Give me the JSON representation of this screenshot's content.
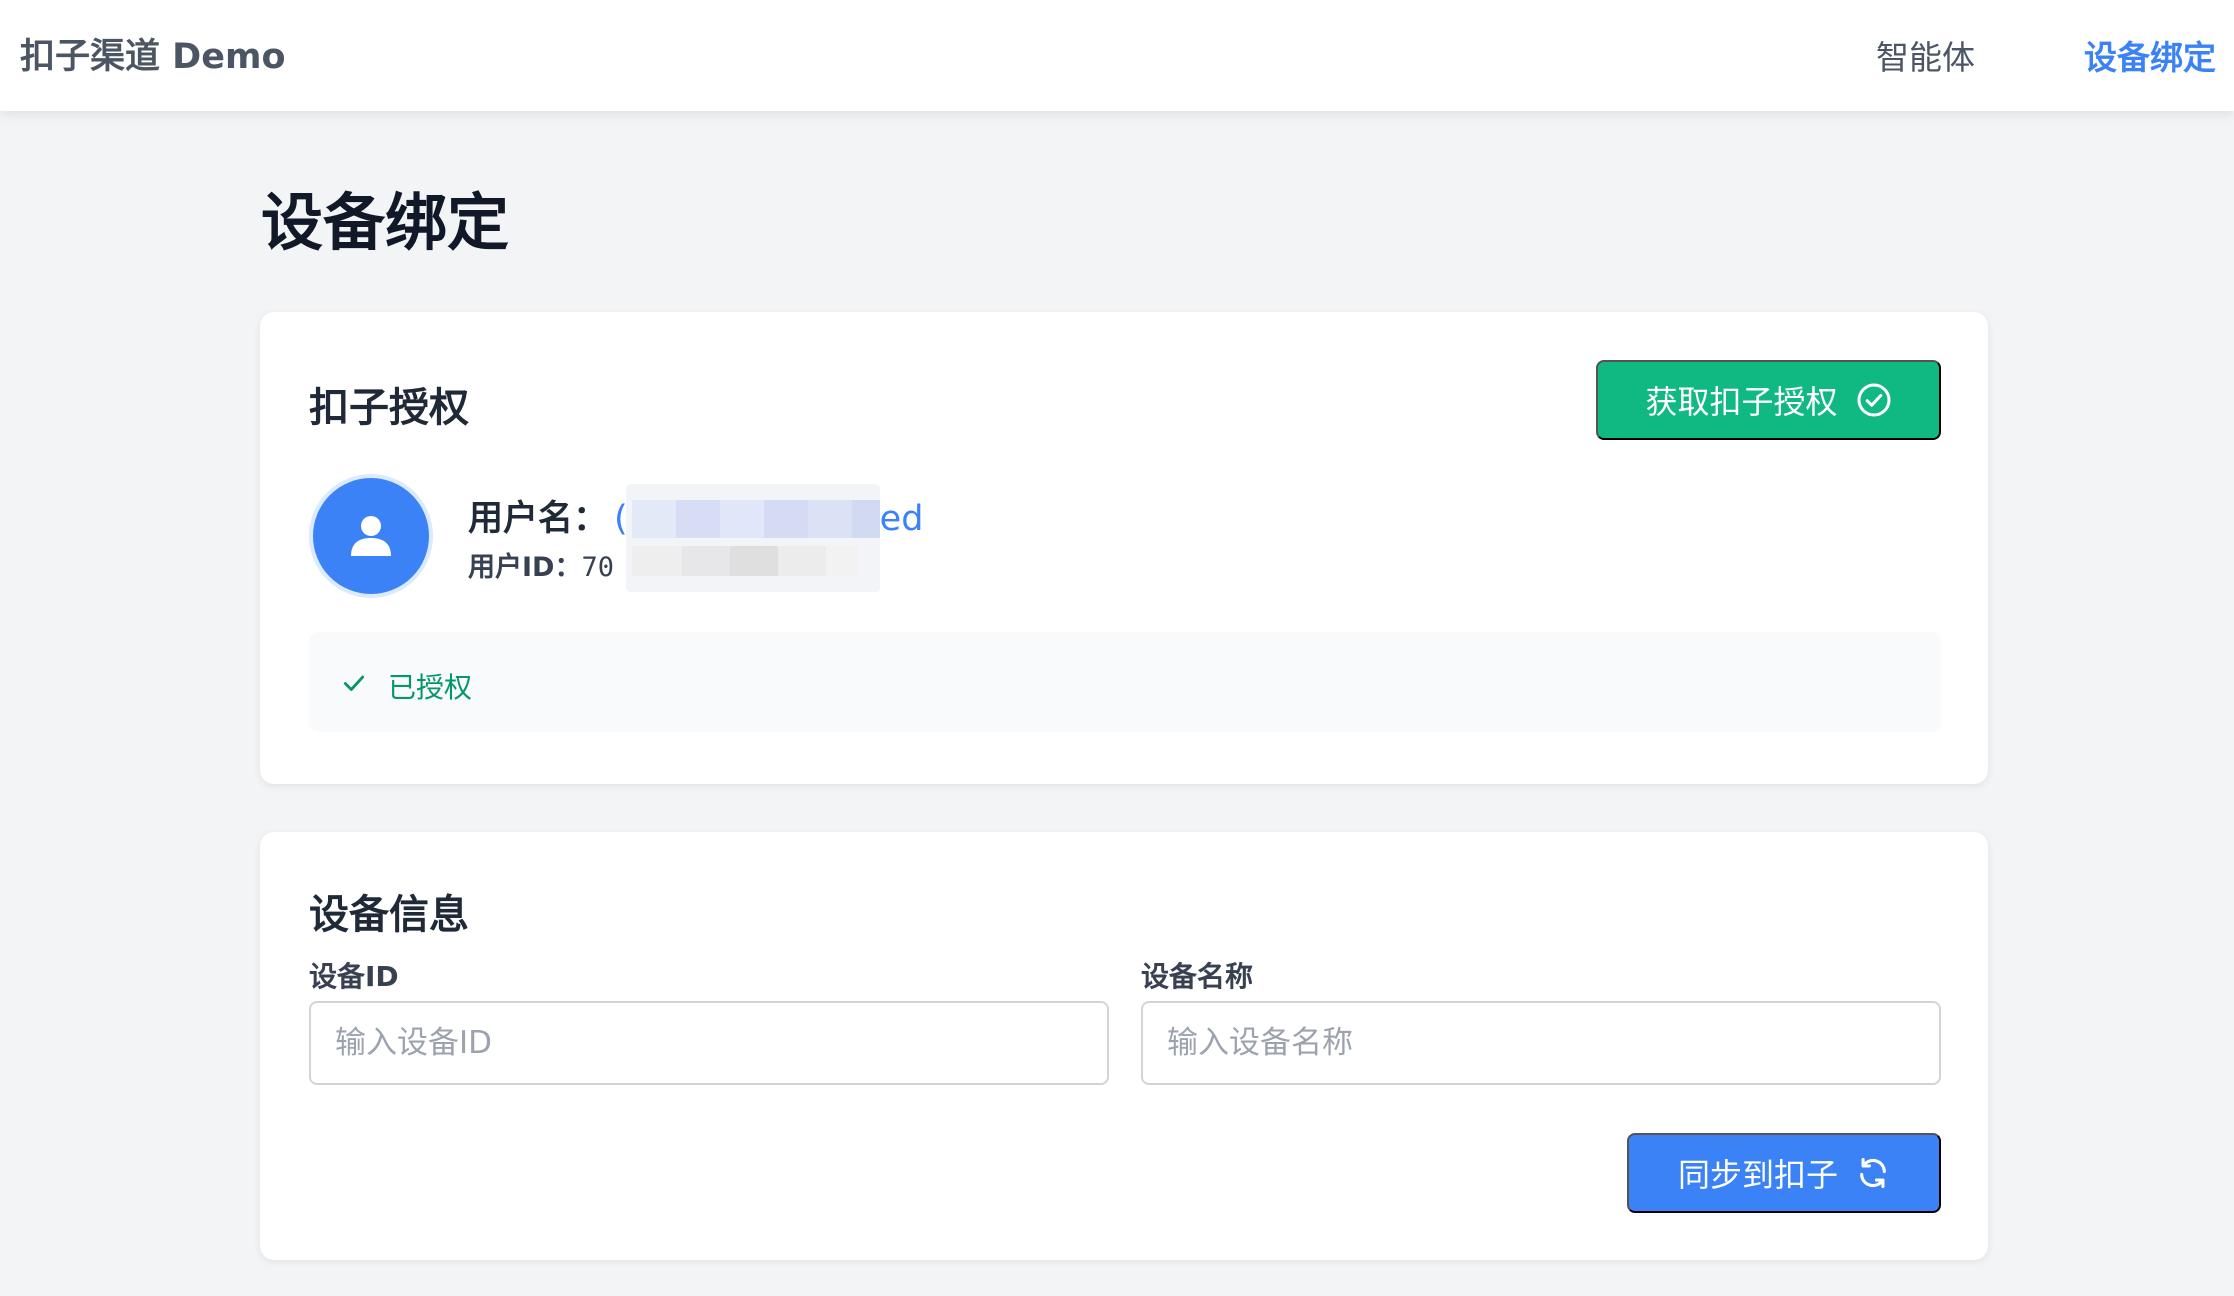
{
  "app": {
    "brand": "扣子渠道 Demo"
  },
  "nav": {
    "items": [
      {
        "label": "智能体",
        "active": false
      },
      {
        "label": "设备绑定",
        "active": true
      }
    ]
  },
  "page": {
    "title": "设备绑定"
  },
  "auth_card": {
    "heading": "扣子授权",
    "auth_button_label": "获取扣子授权",
    "auth_button_icon": "check-circle-icon",
    "user": {
      "avatar_icon": "user-icon",
      "name_label": "用户名：",
      "name_value_visible_start": "(",
      "name_value_visible_end": "ed",
      "id_label": "用户ID：",
      "id_value_visible": "70"
    },
    "status": {
      "icon": "check-icon",
      "text": "已授权"
    }
  },
  "device_card": {
    "heading": "设备信息",
    "device_id_label": "设备ID",
    "device_id_placeholder": "输入设备ID",
    "device_id_value": "",
    "device_name_label": "设备名称",
    "device_name_placeholder": "输入设备名称",
    "device_name_value": "",
    "sync_button_label": "同步到扣子",
    "sync_button_icon": "refresh-icon"
  },
  "colors": {
    "accent_blue": "#3b82f6",
    "success_green": "#10b981",
    "status_green": "#059669",
    "page_background": "#f3f4f6"
  }
}
